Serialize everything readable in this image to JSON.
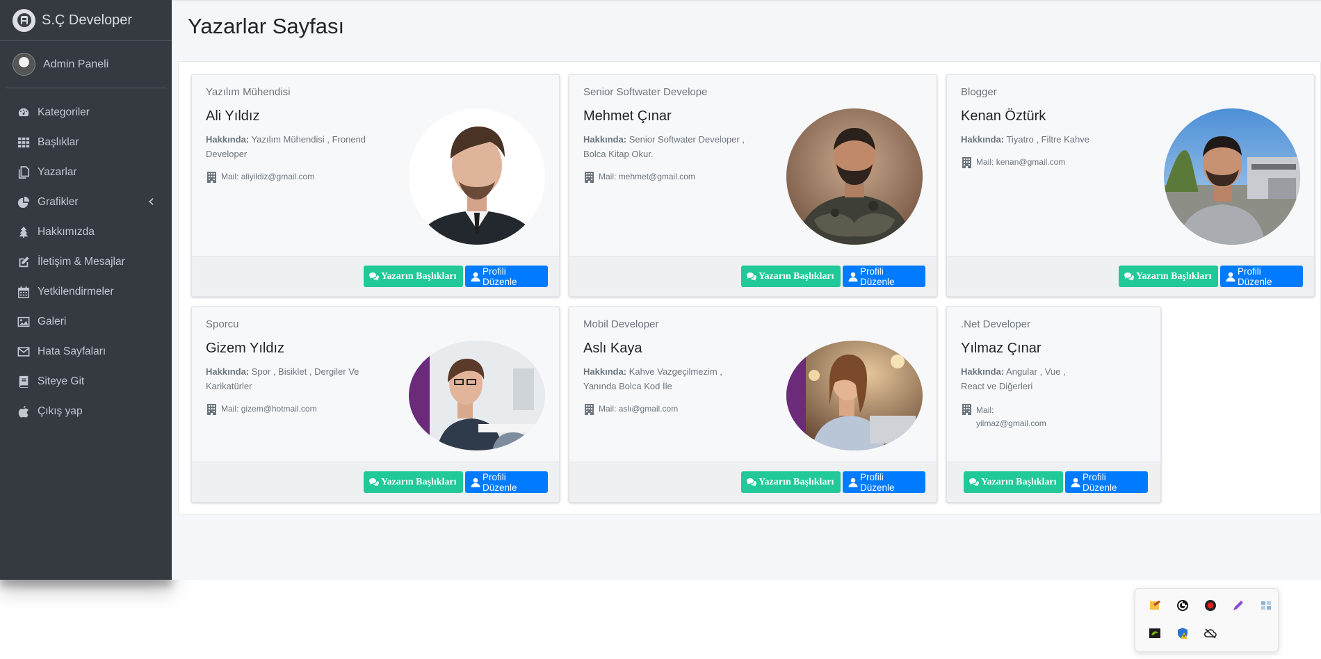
{
  "brand": {
    "name": "S.Ç Developer"
  },
  "user": {
    "name": "Admin Paneli"
  },
  "nav": [
    {
      "label": "Kategoriler",
      "icon": "dashboard-icon"
    },
    {
      "label": "Başlıklar",
      "icon": "grid-icon"
    },
    {
      "label": "Yazarlar",
      "icon": "copy-icon"
    },
    {
      "label": "Grafikler",
      "icon": "pie-chart-icon",
      "has_submenu": true
    },
    {
      "label": "Hakkımızda",
      "icon": "tree-icon"
    },
    {
      "label": "İletişim & Mesajlar",
      "icon": "edit-icon"
    },
    {
      "label": "Yetkilendirmeler",
      "icon": "calendar-icon"
    },
    {
      "label": "Galeri",
      "icon": "image-icon"
    },
    {
      "label": "Hata Sayfaları",
      "icon": "envelope-icon"
    },
    {
      "label": "Siteye Git",
      "icon": "book-icon"
    },
    {
      "label": "Çıkış yap",
      "icon": "apple-icon"
    }
  ],
  "page": {
    "title": "Yazarlar Sayfası"
  },
  "labels": {
    "about": "Hakkında:",
    "mail": "Mail:",
    "headings_button": "Yazarın Başlıkları",
    "edit_button": "Profili Düzenle"
  },
  "authors": [
    {
      "title": "Yazılım Mühendisi",
      "name": "Ali Yıldız",
      "about": "Yazılım Mühendisi , Fronend Developer",
      "mail": "aliyildiz@gmail.com"
    },
    {
      "title": "Senior Softwater Develope",
      "name": "Mehmet Çınar",
      "about": "Senior Softwater Developer , Bolca Kitap Okur.",
      "mail": "mehmet@gmail.com"
    },
    {
      "title": "Blogger",
      "name": "Kenan Öztürk",
      "about": "Tiyatro , Filtre Kahve",
      "mail": "kenan@gmail.com"
    },
    {
      "title": "Sporcu",
      "name": "Gizem Yıldız",
      "about": "Spor , Bisiklet , Dergiler Ve Karikatürler",
      "mail": "gizem@hotmail.com"
    },
    {
      "title": "Mobil Developer",
      "name": "Aslı Kaya",
      "about": "Kahve Vazgeçilmezim , Yanında Bolca Kod İle",
      "mail": "aslı@gmail.com"
    },
    {
      "title": ".Net Developer",
      "name": "Yılmaz Çınar",
      "about": "Angular , Vue , React ve Diğerleri",
      "mail": "yilmaz@gmail.com"
    }
  ],
  "tray": {
    "icons": [
      "sticky-notes-icon",
      "g-hub-icon",
      "record-icon",
      "pen-icon",
      "network-icon",
      "nvidia-icon",
      "shield-alert-icon",
      "cloud-off-icon"
    ]
  }
}
